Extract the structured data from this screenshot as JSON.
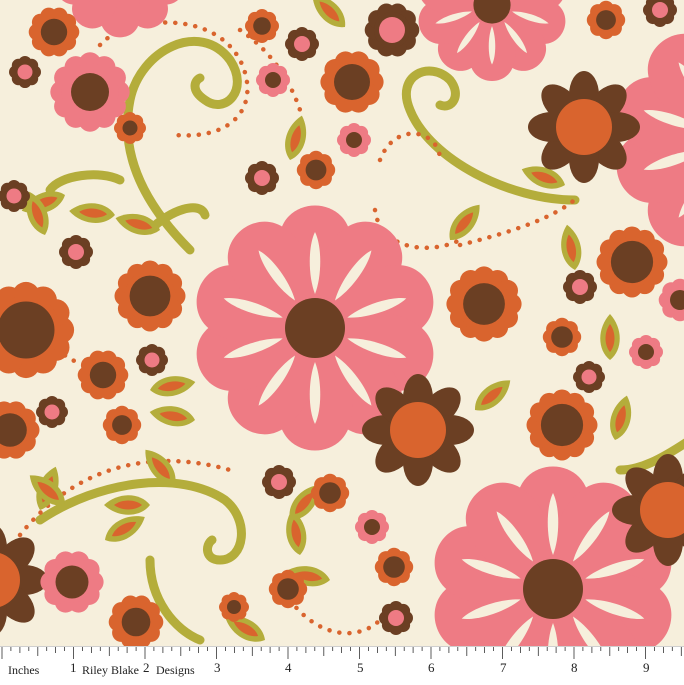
{
  "ruler": {
    "unit_label": "Inches",
    "brand_left": "Riley Blake",
    "brand_right": "Designs",
    "numbers": [
      "1",
      "2",
      "3",
      "4",
      "5",
      "6",
      "7",
      "8",
      "9"
    ]
  },
  "palette": {
    "background": "#f6efdc",
    "pink": "#ee7b84",
    "brown": "#6b3f23",
    "orange": "#d9642e",
    "olive": "#b4ad3b"
  }
}
